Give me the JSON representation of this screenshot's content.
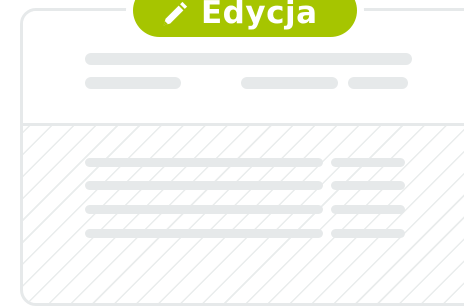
{
  "badge": {
    "label": "Edycja",
    "icon": "pencil-icon",
    "color": "#a6c500"
  },
  "colors": {
    "placeholder": "#e6e9ea",
    "border": "#e6e9ea",
    "background": "#ffffff"
  }
}
